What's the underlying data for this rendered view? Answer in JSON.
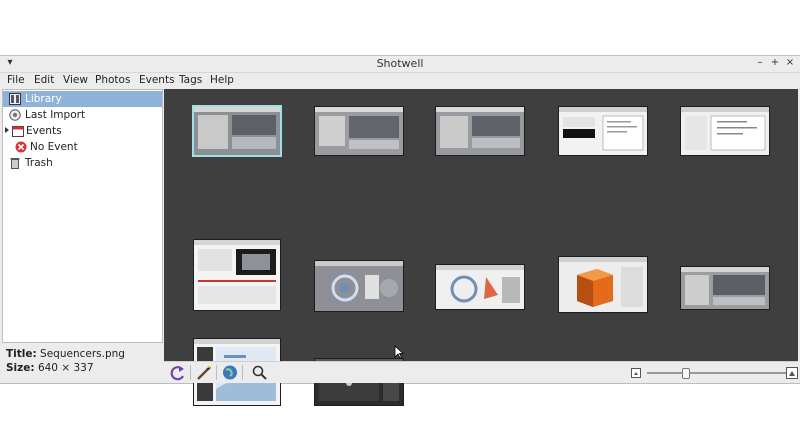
{
  "window": {
    "title": "Shotwell"
  },
  "window_controls": [
    "▾",
    "–",
    "+",
    "×"
  ],
  "menu": [
    "File",
    "Edit",
    "View",
    "Photos",
    "Events",
    "Tags",
    "Help"
  ],
  "sidebar": {
    "items": [
      {
        "label": "Library",
        "icon": "library-icon",
        "selected": true
      },
      {
        "label": "Last Import",
        "icon": "import-icon"
      },
      {
        "label": "Events",
        "icon": "events-icon",
        "expandable": true
      },
      {
        "label": "No Event",
        "icon": "no-event-icon"
      },
      {
        "label": "Trash",
        "icon": "trash-icon"
      }
    ]
  },
  "info": {
    "title_key": "Title:",
    "title_value": "Sequencers.png",
    "size_key": "Size:",
    "size_value": "640 × 337"
  },
  "thumbnails": [
    {
      "kind": "screenshot-gray",
      "selected": true
    },
    {
      "kind": "screenshot-gray"
    },
    {
      "kind": "screenshot-gray"
    },
    {
      "kind": "document-white"
    },
    {
      "kind": "document-white"
    },
    {
      "kind": "screenshot-white"
    },
    {
      "kind": "swirl-gray"
    },
    {
      "kind": "swirl-light"
    },
    {
      "kind": "orange-cube"
    },
    {
      "kind": "screenshot-gray"
    },
    {
      "kind": "presentation"
    },
    {
      "kind": "dark-render"
    }
  ],
  "toolbar": {
    "buttons": [
      "rotate-icon",
      "enhance-icon",
      "publish-icon",
      "search-icon"
    ],
    "zoom_level": 0.27
  },
  "colors": {
    "grid_bg": "#3f3f3f",
    "selection": "#8fb2d9",
    "thumb_selected_border": "#9fe0e6"
  }
}
